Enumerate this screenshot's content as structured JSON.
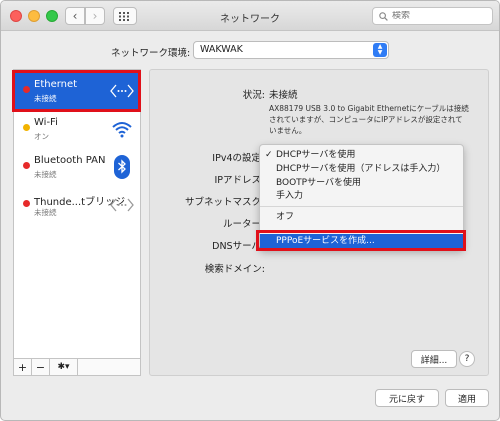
{
  "window": {
    "title": "ネットワーク"
  },
  "search": {
    "placeholder": "検索"
  },
  "location": {
    "label": "ネットワーク環境:",
    "value": "WAKWAK"
  },
  "services": [
    {
      "name": "Ethernet",
      "status": "未接続",
      "dot": "red",
      "icon": "ethernet-icon"
    },
    {
      "name": "Wi-Fi",
      "status": "オン",
      "dot": "amber",
      "icon": "wifi-icon"
    },
    {
      "name": "Bluetooth PAN",
      "status": "未接続",
      "dot": "red",
      "icon": "bluetooth-icon"
    },
    {
      "name": "Thunde...tブリッジ",
      "status": "未接続",
      "dot": "red",
      "icon": "thunderbolt-bridge-icon"
    }
  ],
  "detail": {
    "status_label": "状況:",
    "status_value": "未接続",
    "status_desc": "AX88179 USB 3.0 to Gigabit Ethernetにケーブルは接続されていますが、コンピュータにIPアドレスが設定されていません。",
    "ipv4_label": "IPv4の設定",
    "ip_label": "IPアドレス",
    "subnet_label": "サブネットマスク",
    "router_label": "ルーター",
    "dns_label": "DNSサーバ",
    "search_domain_label": "検索ドメイン:"
  },
  "menu": {
    "items": [
      "DHCPサーバを使用",
      "DHCPサーバを使用（アドレスは手入力）",
      "BOOTPサーバを使用",
      "手入力",
      "オフ",
      "PPPoEサービスを作成..."
    ],
    "check": "✓"
  },
  "buttons": {
    "advanced": "詳細...",
    "help": "?",
    "revert": "元に戻す",
    "apply": "適用"
  },
  "sidebar_tools": {
    "add": "+",
    "remove": "−",
    "gear": "✱▾"
  },
  "colors": {
    "accent": "#1e63d6",
    "highlight": "#e0101a"
  }
}
